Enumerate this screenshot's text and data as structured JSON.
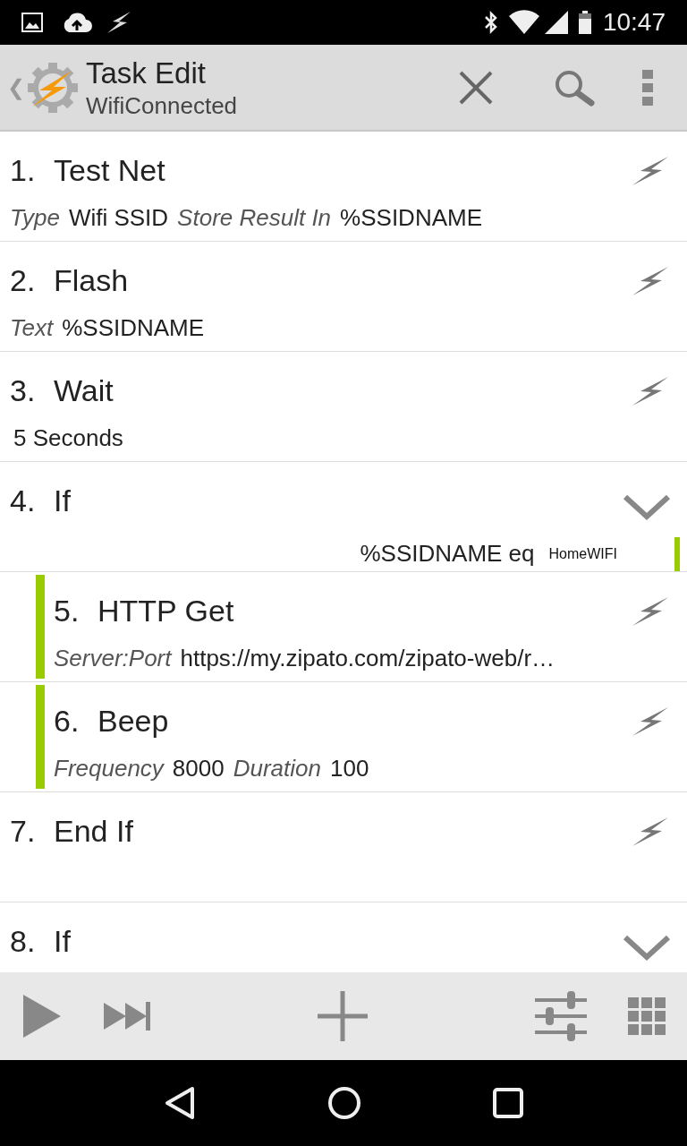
{
  "status_bar": {
    "time": "10:47"
  },
  "action_bar": {
    "back": "❮",
    "title": "Task Edit",
    "subtitle": "WifiConnected"
  },
  "actions": [
    {
      "number": "1.",
      "title": "Test Net",
      "kind": "action",
      "parts": [
        {
          "kind": "label",
          "text": "Type"
        },
        {
          "kind": "value",
          "text": "Wifi SSID"
        },
        {
          "kind": "label",
          "text": "Store Result In"
        },
        {
          "kind": "value",
          "text": "%SSIDNAME"
        }
      ]
    },
    {
      "number": "2.",
      "title": "Flash",
      "kind": "action",
      "parts": [
        {
          "kind": "label",
          "text": "Text"
        },
        {
          "kind": "value",
          "text": "%SSIDNAME"
        }
      ]
    },
    {
      "number": "3.",
      "title": "Wait",
      "kind": "action",
      "parts": [
        {
          "kind": "value",
          "text": "5 Seconds"
        }
      ]
    },
    {
      "number": "4.",
      "title": "If",
      "kind": "block",
      "condition": [
        {
          "kind": "value",
          "text": "%SSIDNAME eq"
        },
        {
          "kind": "small",
          "text": "HomeWIFI"
        }
      ],
      "children": [
        {
          "number": "5.",
          "title": "HTTP Get",
          "kind": "action",
          "parts": [
            {
              "kind": "label",
              "text": "Server:Port"
            },
            {
              "kind": "value",
              "text": "https://my.zipato.com/zipato-web/r…"
            }
          ]
        },
        {
          "number": "6.",
          "title": "Beep",
          "kind": "action",
          "parts": [
            {
              "kind": "label",
              "text": "Frequency"
            },
            {
              "kind": "value",
              "text": "8000"
            },
            {
              "kind": "label",
              "text": "Duration"
            },
            {
              "kind": "value",
              "text": "100"
            }
          ]
        }
      ]
    },
    {
      "number": "7.",
      "title": "End If",
      "kind": "action"
    },
    {
      "number": "8.",
      "title": "If",
      "kind": "block"
    }
  ]
}
